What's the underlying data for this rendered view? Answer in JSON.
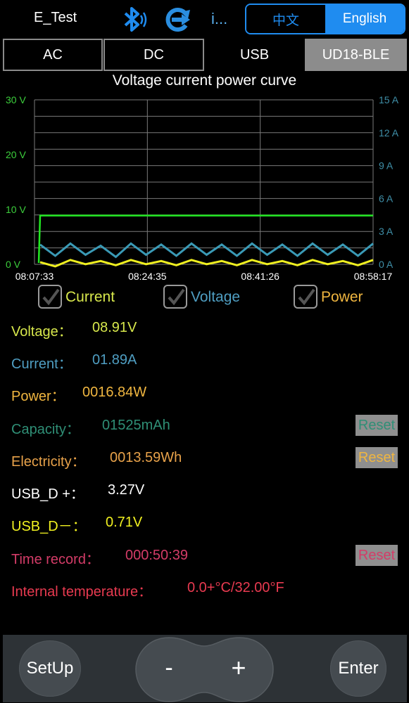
{
  "header": {
    "app_title": "E_Test",
    "more_label": "i...",
    "lang_zh": "中文",
    "lang_en": "English",
    "selected_lang": "English"
  },
  "tabs": [
    {
      "label": "AC",
      "selected": false
    },
    {
      "label": "DC",
      "selected": false
    },
    {
      "label": "USB",
      "selected": false
    },
    {
      "label": "UD18-BLE",
      "selected": true
    }
  ],
  "chart_data": {
    "type": "line",
    "title": "Voltage current power curve",
    "x_ticks": [
      "08:07:33",
      "08:24:35",
      "08:41:26",
      "08:58:17"
    ],
    "left_axis": {
      "ticks": [
        "30 V",
        "20 V",
        "10 V",
        "0 V"
      ],
      "range": [
        0,
        30
      ],
      "color": "#3ccf3c"
    },
    "right_axis": {
      "ticks": [
        "15 A",
        "12 A",
        "9 A",
        "6 A",
        "3 A",
        "0 A"
      ],
      "range": [
        0,
        15
      ],
      "color": "#3f8fa8"
    },
    "grid": true,
    "series": [
      {
        "name": "Voltage",
        "color": "#22e822",
        "axis": "left",
        "values": [
          0,
          8.9,
          8.9,
          8.9,
          8.9,
          8.9,
          8.9,
          8.9,
          8.9,
          8.9,
          8.9,
          8.9
        ]
      },
      {
        "name": "Current",
        "color": "#3a9ab6",
        "axis": "right",
        "values": [
          1.8,
          1.9,
          1.7,
          1.9,
          1.8,
          1.9,
          1.8,
          1.9,
          1.8,
          1.9,
          1.8,
          1.9
        ]
      },
      {
        "name": "Power",
        "color": "#f0f020",
        "axis": "right",
        "values": [
          0.2,
          0.4,
          0.3,
          0.4,
          0.3,
          0.4,
          0.3,
          0.4,
          0.3,
          0.4,
          0.3,
          0.4
        ]
      }
    ]
  },
  "legend": {
    "current_label": "Current",
    "voltage_label": "Voltage",
    "power_label": "Power",
    "colors": {
      "current": "#d8e84c",
      "voltage": "#4f9ec2",
      "power": "#f0b640"
    }
  },
  "readings": {
    "voltage_label": "Voltage：",
    "voltage_value": "08.91V",
    "current_label": "Current：",
    "current_value": "01.89A",
    "power_label": "Power：",
    "power_value": "0016.84W",
    "capacity_label": "Capacity：",
    "capacity_value": "01525mAh",
    "electricity_label": "Electricity：",
    "electricity_value": "0013.59Wh",
    "usb_dp_label": "USB_D +：",
    "usb_dp_value": "3.27V",
    "usb_dm_label": "USB_D－：",
    "usb_dm_value": "0.71V",
    "time_label": "Time record：",
    "time_value": "000:50:39",
    "temp_label": "Internal temperature：",
    "temp_value": "0.0+°C/32.00°F",
    "reset_label": "Reset"
  },
  "colors": {
    "voltage": "#d8e84c",
    "current": "#4f9ec2",
    "power": "#f0b640",
    "capacity": "#2f8f76",
    "electricity": "#e8a24a",
    "usb_dp": "#ffffff",
    "usb_dm": "#f0f020",
    "time": "#d43c68",
    "temp": "#e83a50",
    "accent": "#1f8cf0"
  },
  "controls": {
    "setup_label": "SetUp",
    "minus_label": "-",
    "plus_label": "+",
    "enter_label": "Enter"
  }
}
